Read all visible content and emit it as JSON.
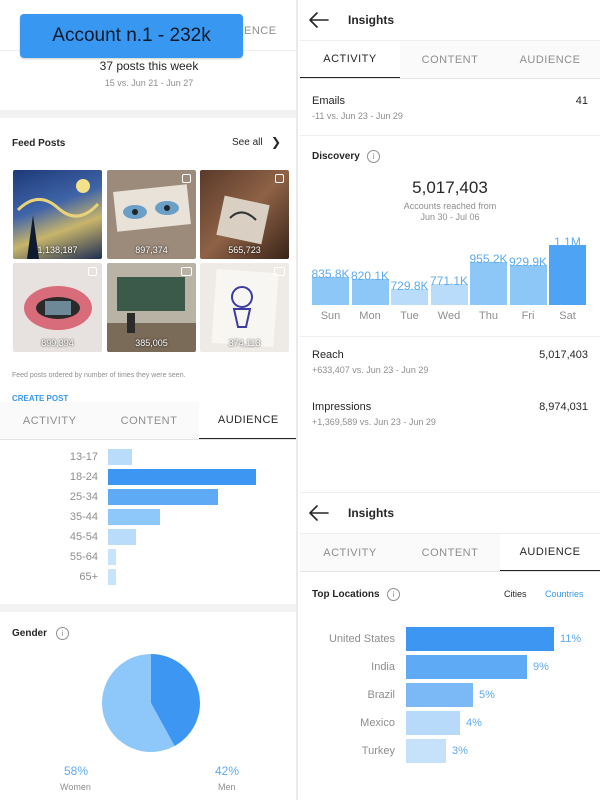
{
  "colors": {
    "accent": "#3897f0",
    "bar_dark": "#3d97f2",
    "bar_mid": "#7ab9f6",
    "bar_light": "#b7dafb"
  },
  "left": {
    "badge": "Account n.1 - 232k",
    "hidden_tab_fragment": "D ENCE",
    "posts_this_week": "37 posts this week",
    "posts_vs": "15 vs. Jun 21 - Jun 27",
    "feed_posts_title": "Feed Posts",
    "see_all": "See all",
    "thumbnails": [
      {
        "count": "1,138,187"
      },
      {
        "count": "897,374"
      },
      {
        "count": "565,723"
      },
      {
        "count": "899,394"
      },
      {
        "count": "385,005"
      },
      {
        "count": "374,113"
      }
    ],
    "feed_note": "Feed posts ordered by number of times they were seen.",
    "create_post": "CREATE POST",
    "tabs": [
      "ACTIVITY",
      "CONTENT",
      "AUDIENCE"
    ],
    "age": [
      {
        "label": "13-17",
        "value": 0.16
      },
      {
        "label": "18-24",
        "value": 1.0
      },
      {
        "label": "25-34",
        "value": 0.74
      },
      {
        "label": "35-44",
        "value": 0.35
      },
      {
        "label": "45-54",
        "value": 0.19
      },
      {
        "label": "55-64",
        "value": 0.05
      },
      {
        "label": "65+",
        "value": 0.04
      }
    ],
    "gender_title": "Gender",
    "gender": {
      "women_pct": "58%",
      "women_label": "Women",
      "women_value": 58,
      "men_pct": "42%",
      "men_label": "Men",
      "men_value": 42
    }
  },
  "right_top": {
    "title": "Insights",
    "tabs": [
      "ACTIVITY",
      "CONTENT",
      "AUDIENCE"
    ],
    "emails": {
      "label": "Emails",
      "value": "41",
      "sub": "-11 vs. Jun 23 - Jun 29"
    },
    "discovery_title": "Discovery",
    "accounts_reached": "5,017,403",
    "accounts_reached_label": "Accounts reached from",
    "accounts_reached_range": "Jun 30 - Jul 06",
    "chart_data": {
      "type": "bar",
      "categories": [
        "Sun",
        "Mon",
        "Tue",
        "Wed",
        "Thu",
        "Fri",
        "Sat"
      ],
      "values": [
        835800,
        820100,
        729800,
        771100,
        955200,
        929900,
        1100000
      ],
      "labels": [
        "835.8K",
        "820.1K",
        "729.8K",
        "771.1K",
        "955.2K",
        "929.9K",
        "1.1M"
      ],
      "ylim": [
        0,
        1100000
      ]
    },
    "reach": {
      "label": "Reach",
      "value": "5,017,403",
      "sub": "+633,407 vs. Jun 23 - Jun 29"
    },
    "impressions": {
      "label": "Impressions",
      "value": "8,974,031",
      "sub": "+1,369,589 vs. Jun 23 - Jun 29"
    }
  },
  "right_bottom": {
    "title": "Insights",
    "tabs": [
      "ACTIVITY",
      "CONTENT",
      "AUDIENCE"
    ],
    "top_locations": "Top Locations",
    "cities": "Cities",
    "countries": "Countries",
    "locations": [
      {
        "name": "United States",
        "pct": "11%",
        "value": 11
      },
      {
        "name": "India",
        "pct": "9%",
        "value": 9
      },
      {
        "name": "Brazil",
        "pct": "5%",
        "value": 5
      },
      {
        "name": "Mexico",
        "pct": "4%",
        "value": 4
      },
      {
        "name": "Turkey",
        "pct": "3%",
        "value": 3
      }
    ]
  }
}
